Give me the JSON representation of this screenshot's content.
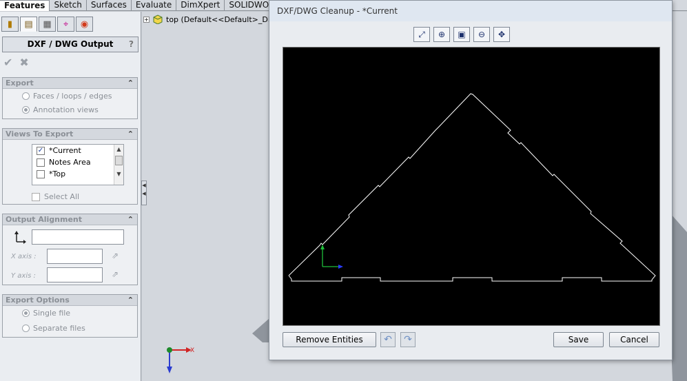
{
  "tabs": [
    "Features",
    "Sketch",
    "Surfaces",
    "Evaluate",
    "DimXpert",
    "SOLIDWORKS C"
  ],
  "property_manager": {
    "title": "DXF / DWG Output",
    "help": "?",
    "ok": "✔",
    "cancel": "✖",
    "toolbar_icons": [
      "feature-manager-icon",
      "property-manager-icon",
      "configuration-manager-icon",
      "dimxpert-manager-icon",
      "display-manager-icon"
    ],
    "export": {
      "title": "Export",
      "options": [
        "Faces / loops / edges",
        "Annotation views"
      ],
      "selected": "Annotation views"
    },
    "views_to_export": {
      "title": "Views To Export",
      "items": [
        {
          "label": "*Current",
          "checked": true
        },
        {
          "label": "Notes Area",
          "checked": false
        },
        {
          "label": "*Top",
          "checked": false
        }
      ],
      "select_all": "Select All"
    },
    "output_alignment": {
      "title": "Output Alignment",
      "origin_value": "",
      "x_axis_label": "X axis :",
      "y_axis_label": "Y axis :",
      "x_axis_value": "",
      "y_axis_value": ""
    },
    "export_options": {
      "title": "Export Options",
      "options": [
        "Single file",
        "Separate files"
      ],
      "selected": "Single file"
    }
  },
  "tree": {
    "expander": "+",
    "text": "top  (Default<<Default>_Di..."
  },
  "dialog": {
    "title": "DXF/DWG Cleanup - *Current",
    "toolbar_icons": [
      "zoom-to-fit-icon",
      "zoom-in-icon",
      "zoom-to-area-icon",
      "zoom-out-icon",
      "pan-icon"
    ],
    "remove_button": "Remove Entities",
    "undo_icon": "undo-icon",
    "redo_icon": "redo-icon",
    "save_button": "Save",
    "cancel_button": "Cancel",
    "colors": {
      "canvas": "#000000",
      "geometry": "#ffffff",
      "y_axis": "#1fbf3a",
      "x_axis": "#2a3cff"
    }
  },
  "triad": {
    "x_label": "X",
    "y_label": "Y"
  }
}
